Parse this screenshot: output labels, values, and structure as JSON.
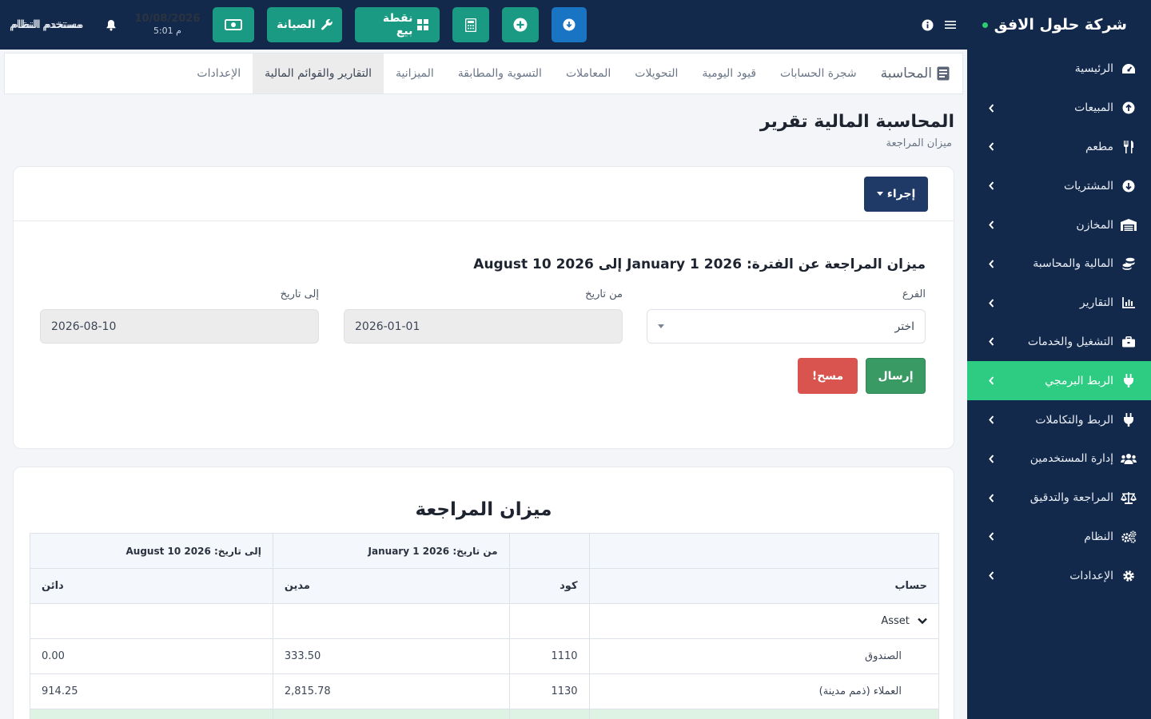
{
  "app": {
    "company": "شركة حلول الافق"
  },
  "colors": {
    "sidebar_bg": "#13294b",
    "active_green": "#2ecc82",
    "teal": "#1a9a82",
    "blue": "#1a74c4",
    "danger": "#d9534f",
    "success": "#3a9a64"
  },
  "sidebar": {
    "items": [
      {
        "label": "الرئيسية",
        "icon": "dashboard-icon",
        "has_children": false,
        "active": false
      },
      {
        "label": "المبيعات",
        "icon": "arrow-up-circle-icon",
        "has_children": true,
        "active": false
      },
      {
        "label": "مطعم",
        "icon": "utensils-icon",
        "has_children": true,
        "active": false
      },
      {
        "label": "المشتريات",
        "icon": "arrow-down-circle-icon",
        "has_children": true,
        "active": false
      },
      {
        "label": "المخازن",
        "icon": "warehouse-icon",
        "has_children": true,
        "active": false
      },
      {
        "label": "المالية والمحاسبة",
        "icon": "coins-icon",
        "has_children": true,
        "active": false
      },
      {
        "label": "التقارير",
        "icon": "chart-icon",
        "has_children": true,
        "active": false
      },
      {
        "label": "التشغيل والخدمات",
        "icon": "briefcase-icon",
        "has_children": true,
        "active": false
      },
      {
        "label": "الربط البرمجي",
        "icon": "plug-icon",
        "has_children": true,
        "active": true
      },
      {
        "label": "الربط والتكاملات",
        "icon": "plug-icon",
        "has_children": true,
        "active": false
      },
      {
        "label": "إدارة المستخدمين",
        "icon": "users-icon",
        "has_children": true,
        "active": false
      },
      {
        "label": "المراجعة والتدقيق",
        "icon": "scale-icon",
        "has_children": true,
        "active": false
      },
      {
        "label": "النظام",
        "icon": "cogs-icon",
        "has_children": true,
        "active": false
      },
      {
        "label": "الإعدادات",
        "icon": "gear-icon",
        "has_children": true,
        "active": false
      }
    ]
  },
  "topbar": {
    "maintenance_label": "الصيانة",
    "pos_label": "نقطة بيع",
    "date": "10/08/2026",
    "time": "5:01 م",
    "user": "مستخدم النظام"
  },
  "tabs": {
    "brand": "المحاسبة",
    "items": [
      {
        "label": "شجرة الحسابات",
        "active": false
      },
      {
        "label": "قيود اليومية",
        "active": false
      },
      {
        "label": "التحويلات",
        "active": false
      },
      {
        "label": "المعاملات",
        "active": false
      },
      {
        "label": "التسوية والمطابقة",
        "active": false
      },
      {
        "label": "الميزانية",
        "active": false
      },
      {
        "label": "التقارير والقوائم المالية",
        "active": true
      },
      {
        "label": "الإعدادات",
        "active": false
      }
    ]
  },
  "page": {
    "title": "المحاسبة المالية تقرير",
    "subtitle": "ميزان المراجعة"
  },
  "form": {
    "action_label": "إجراء",
    "heading": "ميزان المراجعة عن الفترة: January 1 2026 إلى August 10 2026",
    "branch_label": "الفرع",
    "branch_value": "اختر",
    "from_label": "من تاريخ",
    "from_value": "2026-01-01",
    "to_label": "إلى تاريخ",
    "to_value": "2026-08-10",
    "send_label": "إرسال",
    "clear_label": "مسح!"
  },
  "report": {
    "title": "ميزان المراجعة",
    "from_header": "من تاريخ: January 1 2026",
    "to_header": "إلى تاريخ: August 10 2026",
    "col_account": "حساب",
    "col_code": "كود",
    "col_debit": "مدين",
    "col_credit": "دائن",
    "group": "Asset",
    "rows": [
      {
        "account": "الصندوق",
        "code": "1110",
        "debit": "333.50",
        "credit": "0.00"
      },
      {
        "account": "العملاء (ذمم مدينة)",
        "code": "1130",
        "debit": "2,815.78",
        "credit": "914.25"
      }
    ]
  }
}
